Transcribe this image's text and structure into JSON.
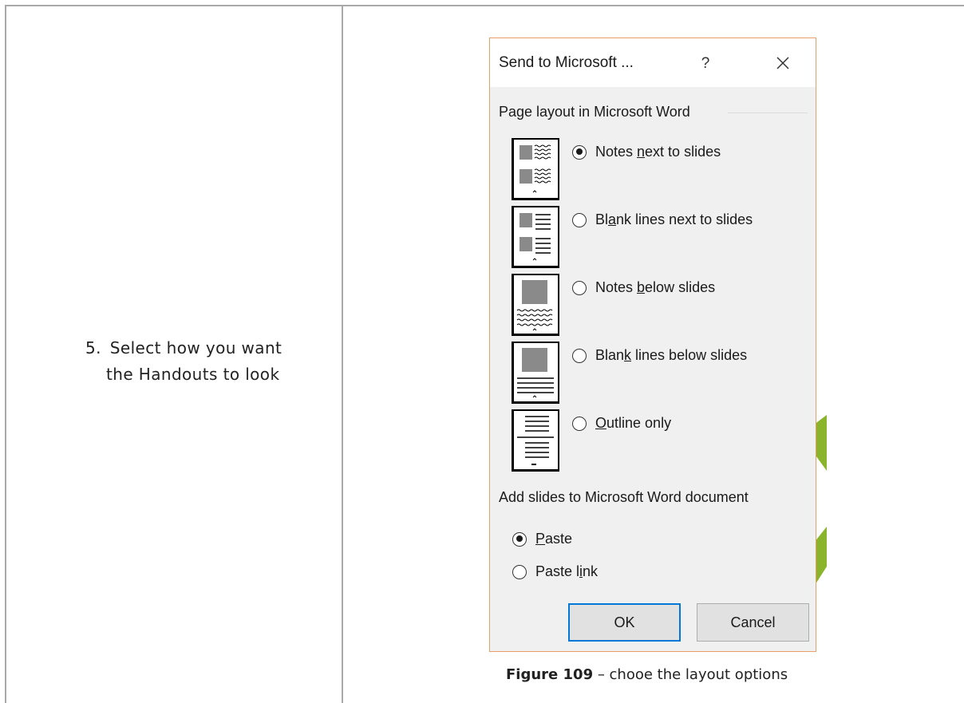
{
  "instruction": {
    "number": "5.",
    "line1": "Select how you want",
    "line2": "the Handouts to look"
  },
  "dialog": {
    "title": "Send to Microsoft ...",
    "help_glyph": "?",
    "page_layout_group": {
      "label": "Page layout in Microsoft Word",
      "options": [
        {
          "before": "Notes ",
          "accel": "n",
          "after": "ext to slides",
          "checked": true,
          "thumbnail": "notes-next-to-slides-icon"
        },
        {
          "before": "Bl",
          "accel": "a",
          "after": "nk lines next to slides",
          "checked": false,
          "thumbnail": "blank-lines-next-to-slides-icon"
        },
        {
          "before": "Notes ",
          "accel": "b",
          "after": "elow slides",
          "checked": false,
          "thumbnail": "notes-below-slides-icon"
        },
        {
          "before": "Blan",
          "accel": "k",
          "after": " lines below slides",
          "checked": false,
          "thumbnail": "blank-lines-below-slides-icon"
        },
        {
          "before": "",
          "accel": "O",
          "after": "utline only",
          "checked": false,
          "thumbnail": "outline-only-icon"
        }
      ]
    },
    "add_slides_group": {
      "label": "Add slides to Microsoft Word document",
      "options": [
        {
          "before": "",
          "accel": "P",
          "after": "aste",
          "checked": true
        },
        {
          "before": "Paste l",
          "accel": "i",
          "after": "nk",
          "checked": false
        }
      ]
    },
    "ok_label": "OK",
    "cancel_label": "Cancel",
    "colors": {
      "dialog_bg": "#f0f0f0",
      "border": "#e8a06a",
      "focus_blue": "#0078d7",
      "accent_green": "#8bb42d"
    }
  },
  "caption": {
    "label": "Figure 109",
    "text": " – chooe the layout options"
  }
}
